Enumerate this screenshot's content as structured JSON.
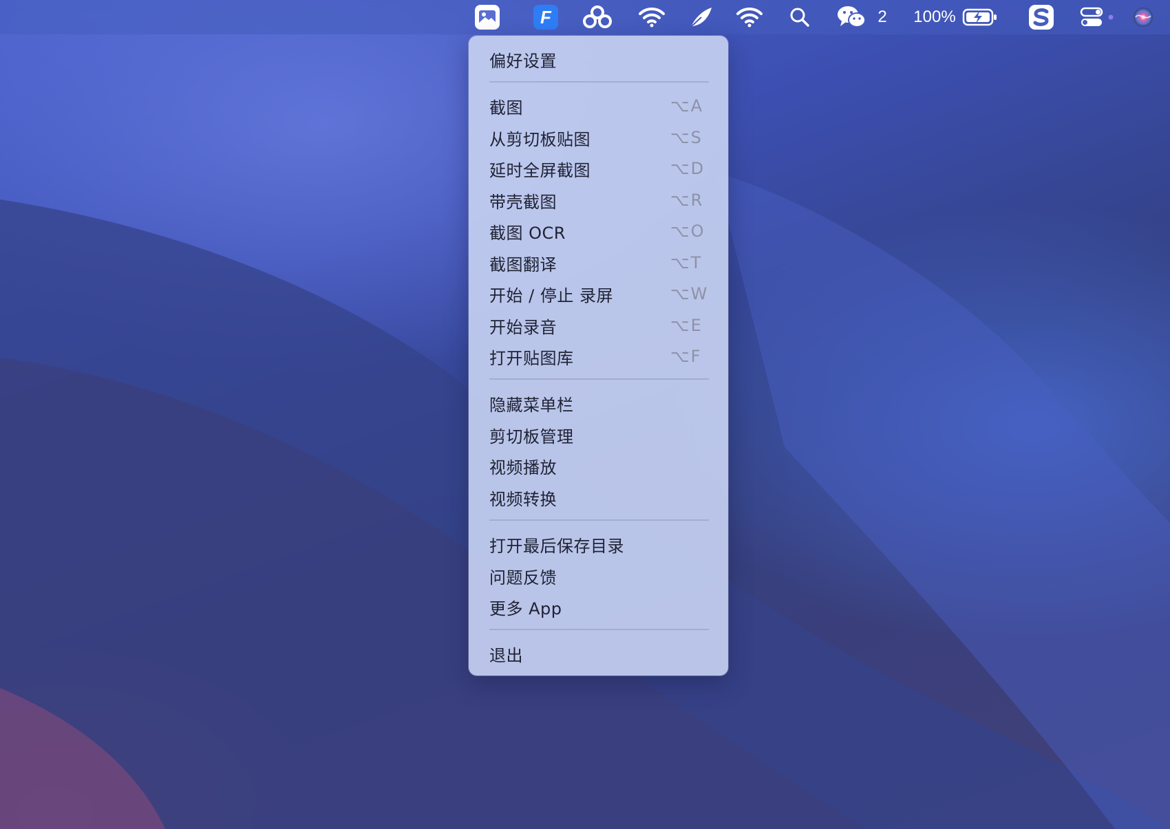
{
  "menubar": {
    "icons": [
      "image-app-icon",
      "f-app-icon",
      "baidu-netdisk-icon",
      "wifi-icon",
      "feather-app-icon",
      "wifi-icon",
      "search-icon",
      "wechat-icon",
      "battery-icon",
      "s-app-icon",
      "control-center-icon",
      "siri-icon"
    ],
    "wechat_count": "2",
    "battery_percent": "100%"
  },
  "menu": {
    "preferences": "偏好设置",
    "capture_group": [
      {
        "label": "截图",
        "shortcut": "⌥A"
      },
      {
        "label": "从剪切板贴图",
        "shortcut": "⌥S"
      },
      {
        "label": "延时全屏截图",
        "shortcut": "⌥D"
      },
      {
        "label": "带壳截图",
        "shortcut": "⌥R"
      },
      {
        "label": "截图 OCR",
        "shortcut": "⌥O"
      },
      {
        "label": "截图翻译",
        "shortcut": "⌥T"
      },
      {
        "label": "开始 / 停止 录屏",
        "shortcut": "⌥W"
      },
      {
        "label": "开始录音",
        "shortcut": "⌥E"
      },
      {
        "label": "打开贴图库",
        "shortcut": "⌥F"
      }
    ],
    "tools_group": [
      "隐藏菜单栏",
      "剪切板管理",
      "视频播放",
      "视频转换"
    ],
    "misc_group": [
      "打开最后保存目录",
      "问题反馈",
      "更多 App"
    ],
    "quit": "退出"
  },
  "colors": {
    "menu_background": "#c4cff0",
    "menu_text": "#1f2233",
    "shortcut_text": "#8d92a6",
    "menubar_background": "#465cbe"
  }
}
